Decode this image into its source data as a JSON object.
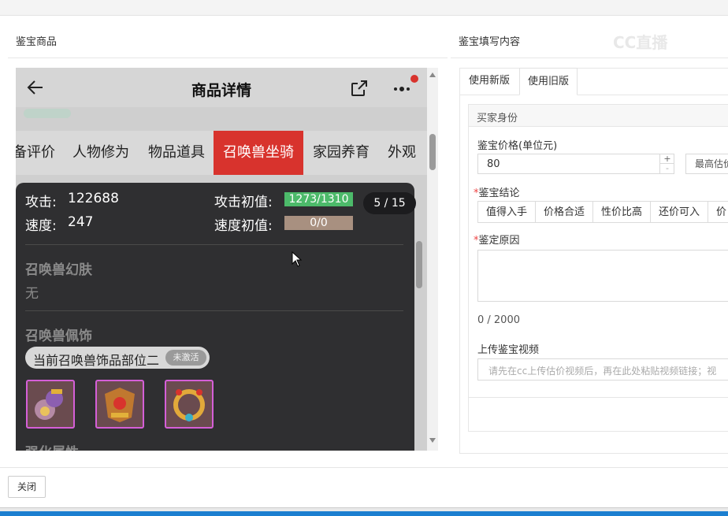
{
  "left_panel": {
    "title": "鉴宝商品"
  },
  "right_panel": {
    "title": "鉴宝填写内容",
    "watermark": "CC直播"
  },
  "phone": {
    "header_title": "商品详情",
    "categories": [
      "备评价",
      "人物修为",
      "物品道具",
      "召唤兽坐骑",
      "家园养育",
      "外观"
    ],
    "active_category": "召唤兽坐骑",
    "stats": {
      "attack_label": "攻击:",
      "attack_value": "122688",
      "speed_label": "速度:",
      "speed_value": "247",
      "attack_init_label": "攻击初值:",
      "attack_init_value": "1273/1310",
      "speed_init_label": "速度初值:",
      "speed_init_value": "0/0"
    },
    "page_counter": "5 / 15",
    "skin_heading": "召唤兽幻肤",
    "skin_value": "无",
    "accessory_heading": "召唤兽佩饰",
    "accessory_current": "当前召唤兽饰品部位二",
    "accessory_badge": "未激活",
    "next_heading": "强化属性"
  },
  "tabs": [
    {
      "label": "使用新版",
      "active": false
    },
    {
      "label": "使用旧版",
      "active": true
    }
  ],
  "form": {
    "buyer_identity_label": "买家身份",
    "price_label": "鉴宝价格(单位元)",
    "price_value": "80",
    "max_label": "最高估价",
    "conclusion_label": "鉴宝结论",
    "conclusion_options": [
      "值得入手",
      "价格合适",
      "性价比高",
      "还价可入",
      "价"
    ],
    "reason_label": "鉴定原因",
    "reason_counter": "0 / 2000",
    "video_label": "上传鉴宝视频",
    "video_placeholder": "请先在cc上传估价视频后，再在此处粘贴视频链接；视"
  },
  "footer": {
    "close_label": "关闭"
  },
  "colors": {
    "active_category": "#d8332d",
    "attack_init_bar": "#4cba6a",
    "speed_init_bar": "#a89080",
    "required": "#ee4444"
  }
}
